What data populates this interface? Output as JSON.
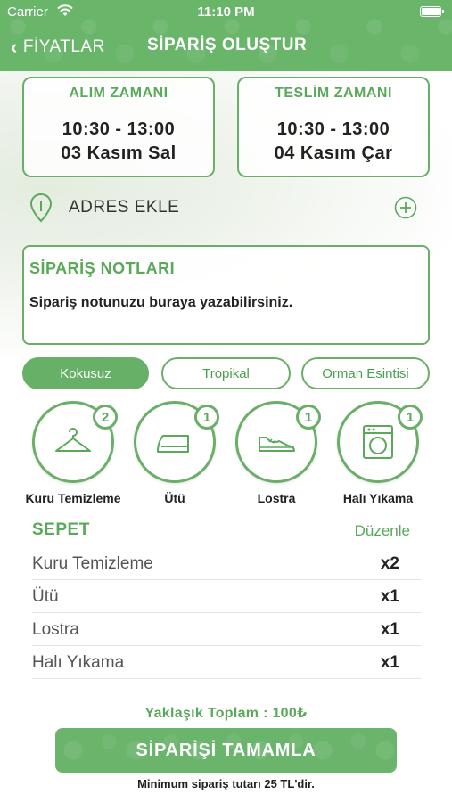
{
  "status_bar": {
    "carrier": "Carrier",
    "time": "11:10 PM"
  },
  "nav": {
    "back_label": "FİYATLAR",
    "title": "SİPARİŞ OLUŞTUR"
  },
  "pickup": {
    "label": "ALIM ZAMANI",
    "hours": "10:30 - 13:00",
    "date": "03 Kasım Sal"
  },
  "delivery": {
    "label": "TESLİM ZAMANI",
    "hours": "10:30 - 13:00",
    "date": "04 Kasım Çar"
  },
  "address": {
    "label": "ADRES EKLE"
  },
  "notes": {
    "title": "SİPARİŞ NOTLARI",
    "placeholder": "Sipariş notunuzu buraya yazabilirsiniz."
  },
  "scents": [
    {
      "label": "Kokusuz",
      "selected": true
    },
    {
      "label": "Tropikal",
      "selected": false
    },
    {
      "label": "Orman Esintisi",
      "selected": false
    }
  ],
  "services": [
    {
      "label": "Kuru Temizleme",
      "count": "2",
      "icon": "hanger-icon"
    },
    {
      "label": "Ütü",
      "count": "1",
      "icon": "iron-icon"
    },
    {
      "label": "Lostra",
      "count": "1",
      "icon": "shoe-icon"
    },
    {
      "label": "Halı Yıkama",
      "count": "1",
      "icon": "washing-machine-icon"
    }
  ],
  "cart": {
    "title": "SEPET",
    "edit_label": "Düzenle",
    "items": [
      {
        "name": "Kuru Temizleme",
        "qty": "x2"
      },
      {
        "name": "Ütü",
        "qty": "x1"
      },
      {
        "name": "Lostra",
        "qty": "x1"
      },
      {
        "name": "Halı Yıkama",
        "qty": "x1"
      }
    ]
  },
  "total": "Yaklaşık Toplam : 100₺",
  "complete_button": "SİPARİŞİ TAMAMLA",
  "min_note": "Minimum sipariş tutarı 25 TL'dir.",
  "colors": {
    "brand_green": "#69b56a",
    "text_dark": "#222222"
  }
}
